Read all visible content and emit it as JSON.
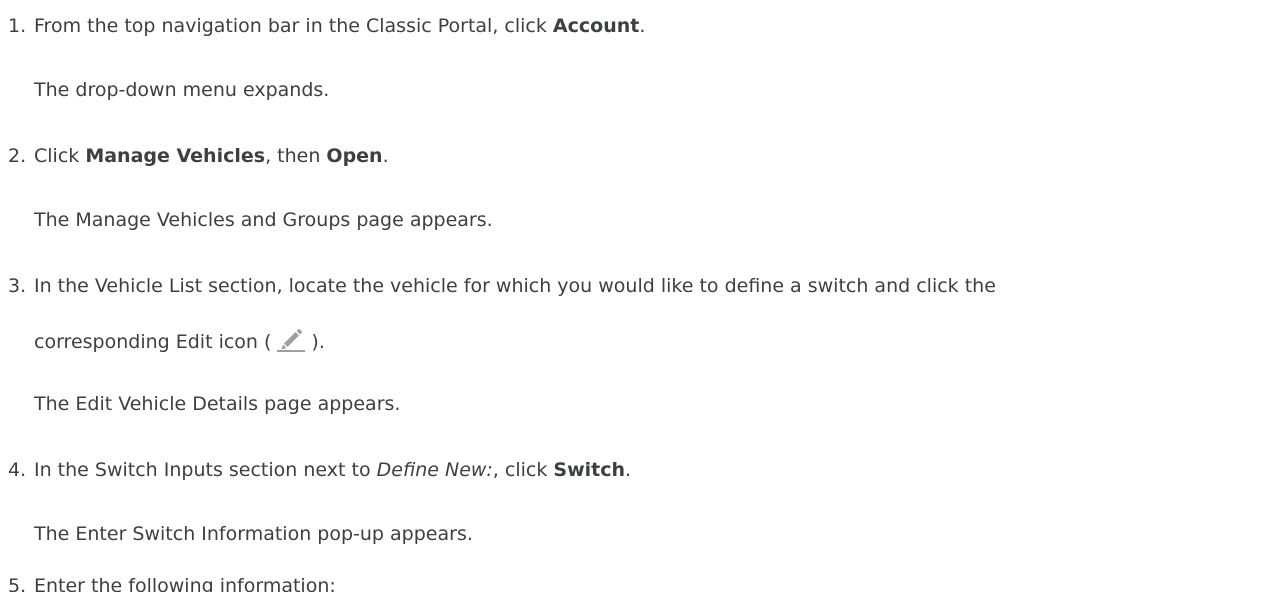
{
  "steps": [
    {
      "number": "1.",
      "parts": [
        "From the top navigation bar in the Classic Portal, click ",
        "Account",
        "."
      ],
      "result": "The drop-down menu expands."
    },
    {
      "number": "2.",
      "parts": [
        "Click ",
        "Manage Vehicles",
        ", then ",
        "Open",
        "."
      ],
      "result": "The Manage Vehicles and Groups page appears."
    },
    {
      "number": "3.",
      "line1": "In the Vehicle List section, locate the vehicle for which you would like to define a switch and click the",
      "line2_before": "corresponding Edit icon (",
      "line2_after": ").",
      "icon": "pencil-edit-icon",
      "icon_color": "#9aa0a6",
      "result": "The Edit Vehicle Details page appears."
    },
    {
      "number": "4.",
      "parts": [
        "In the Switch Inputs section next to ",
        "Define New:",
        ", click ",
        "Switch",
        "."
      ],
      "result": "The Enter Switch Information pop-up appears."
    },
    {
      "number": "5.",
      "parts": [
        "Enter the following information:"
      ]
    }
  ]
}
